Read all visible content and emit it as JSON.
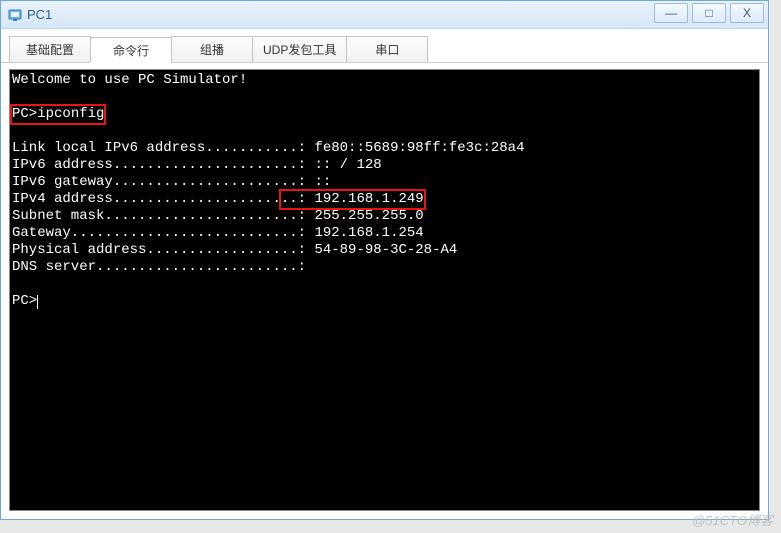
{
  "window": {
    "title": "PC1",
    "min_symbol": "—",
    "max_symbol": "□",
    "close_symbol": "X"
  },
  "tabs": [
    {
      "label": "基础配置",
      "active": false
    },
    {
      "label": "命令行",
      "active": true
    },
    {
      "label": "组播",
      "active": false
    },
    {
      "label": "UDP发包工具",
      "active": false
    },
    {
      "label": "串口",
      "active": false
    }
  ],
  "terminal": {
    "welcome": "Welcome to use PC Simulator!",
    "prompt1": "PC>",
    "command1": "ipconfig",
    "lines": {
      "ll_ipv6_label": "Link local IPv6 address...........: ",
      "ll_ipv6_val": "fe80::5689:98ff:fe3c:28a4",
      "ipv6_label": "IPv6 address......................: ",
      "ipv6_val": ":: / 128",
      "ipv6_gw_label": "IPv6 gateway......................: ",
      "ipv6_gw_val": "::",
      "ipv4_label": "IPv4 address....................",
      "ipv4_sep": "..: ",
      "ipv4_val": "192.168.1.249",
      "subnet_label": "Subnet mask.......................: ",
      "subnet_val": "255.255.255.0",
      "gw_label": "Gateway...........................: ",
      "gw_val": "192.168.1.254",
      "phys_label": "Physical address..................: ",
      "phys_val": "54-89-98-3C-28-A4",
      "dns_label": "DNS server........................:",
      "dns_val": ""
    },
    "prompt2": "PC>"
  },
  "watermark": "@51CTO博客"
}
